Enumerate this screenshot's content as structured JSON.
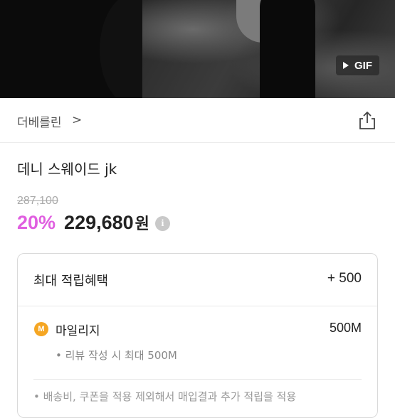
{
  "hero": {
    "badge_label": "GIF",
    "badge_icon": "play-triangle-icon"
  },
  "brand": {
    "name": "더베를린",
    "chevron": ">",
    "chevron_icon": "chevron-right-icon",
    "share_icon": "share-icon"
  },
  "product": {
    "title": "데니 스웨이드 jk",
    "original_price": "287,100",
    "discount": "20%",
    "price": "229,680",
    "price_unit": "원",
    "info_glyph": "i",
    "info_icon": "info-icon"
  },
  "benefit": {
    "title": "최대 적립혜택",
    "total": "+ 500",
    "mileage_icon_glyph": "M",
    "mileage_label": "마일리지",
    "mileage_value": "500M",
    "mileage_note": "• 리뷰 작성 시 최대 500M",
    "cut_text": "• 배송비, 쿠폰을 적용 제외해서 매입결과 추가 적립을 적용"
  },
  "colors": {
    "discount": "#e05fe0",
    "mileage_coin": "#f5a623"
  }
}
